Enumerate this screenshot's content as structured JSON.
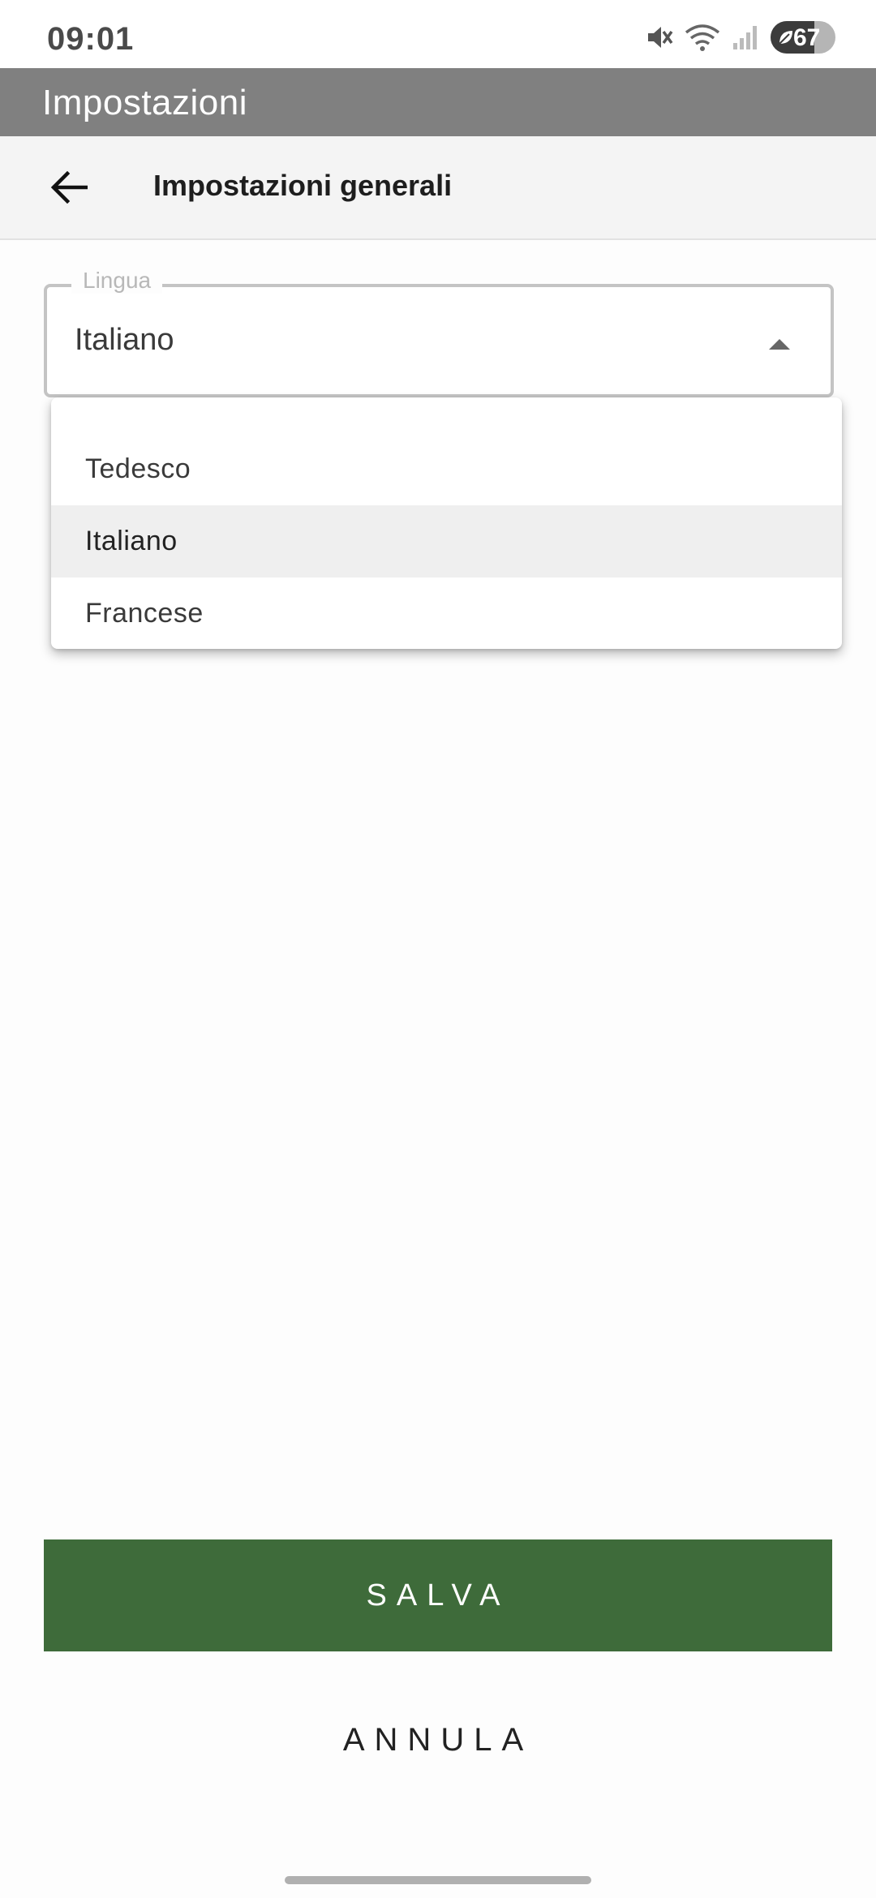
{
  "status_bar": {
    "time": "09:01",
    "icons": [
      "mute-icon",
      "wifi-icon",
      "signal-icon",
      "battery-icon"
    ],
    "battery_level": "67",
    "battery_fraction": 0.67
  },
  "app_bar": {
    "title": "Impostazioni"
  },
  "sub_header": {
    "back_icon": "arrow-left-icon",
    "title": "Impostazioni generali"
  },
  "language_field": {
    "label": "Lingua",
    "value": "Italiano",
    "arrow_icon": "caret-up-icon"
  },
  "dropdown": {
    "options": [
      "Tedesco",
      "Italiano",
      "Francese"
    ],
    "selected": "Italiano"
  },
  "actions": {
    "save_label": "SALVA",
    "cancel_label": "ANNULA"
  },
  "colors": {
    "app_bar": "#808080",
    "primary": "#3e6b3a",
    "sub_header": "#f4f4f4"
  }
}
